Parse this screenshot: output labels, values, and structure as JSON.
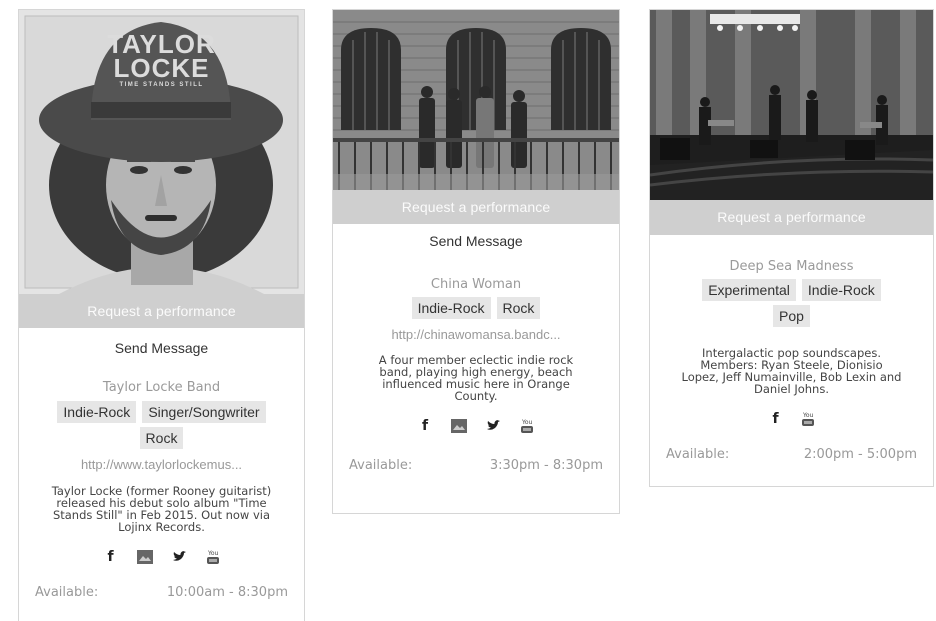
{
  "cards": [
    {
      "request_label": "Request a performance",
      "send_message_label": "Send Message",
      "band_name": "Taylor Locke Band",
      "tags": [
        "Indie-Rock",
        "Singer/Songwriter",
        "Rock"
      ],
      "website": "http://www.taylorlockemus...",
      "description": "Taylor Locke (former Rooney guitarist) released his debut solo album \"Time Stands Still\" in Feb 2015. Out now via Lojinx Records.",
      "available_label": "Available:",
      "available_time": "10:00am - 8:30pm",
      "photo_text": [
        "TAYLOR",
        "LOCKE",
        "TIME STANDS STILL"
      ]
    },
    {
      "request_label": "Request a performance",
      "send_message_label": "Send Message",
      "band_name": "China Woman",
      "tags": [
        "Indie-Rock",
        "Rock"
      ],
      "website": "http://chinawomansa.bandc...",
      "description": "A four member eclectic indie rock band, playing high energy, beach influenced music here in Orange County.",
      "available_label": "Available:",
      "available_time": "3:30pm - 8:30pm"
    },
    {
      "request_label": "Request a performance",
      "band_name": "Deep Sea Madness",
      "tags": [
        "Experimental",
        "Indie-Rock",
        "Pop"
      ],
      "description": "Intergalactic pop soundscapes. Members: Ryan Steele, Dionisio Lopez, Jeff Numainville, Bob Lexin and Daniel Johns.",
      "available_label": "Available:",
      "available_time": "2:00pm - 5:00pm"
    }
  ],
  "social_icons": [
    "facebook-icon",
    "image-icon",
    "twitter-icon",
    "youtube-icon"
  ]
}
